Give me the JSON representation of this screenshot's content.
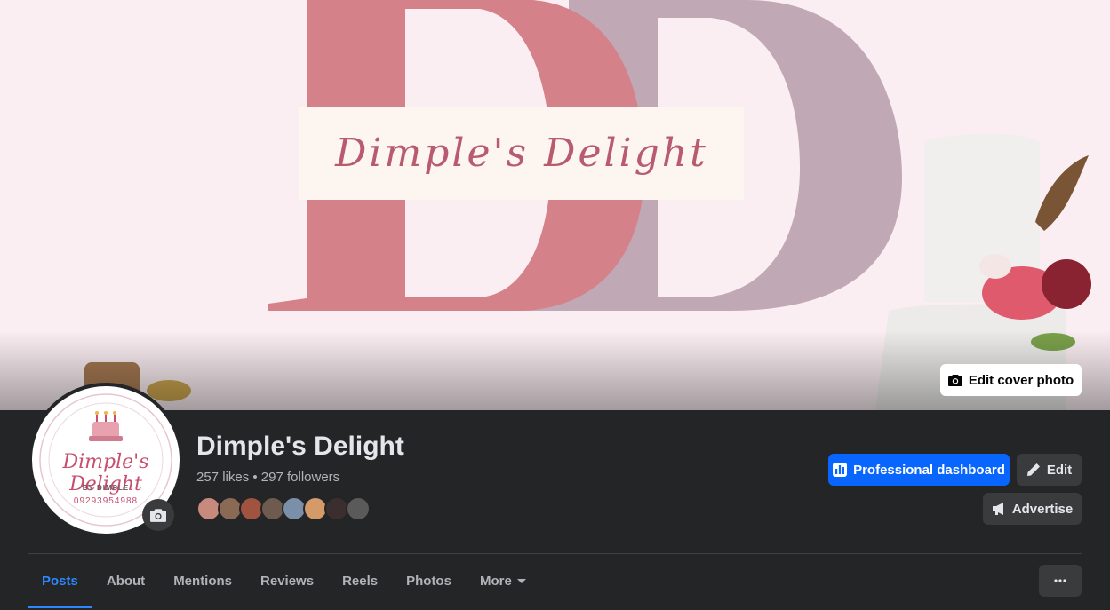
{
  "cover": {
    "banner_text": "Dimple's Delight",
    "edit_cover_label": "Edit cover photo",
    "colors": {
      "background": "#fbeef3",
      "rose": "#d58189",
      "mauve": "#c0a8b4"
    }
  },
  "profile": {
    "avatar_name": "Dimple's Delight",
    "avatar_sub": "BY DIMPLE",
    "avatar_phone": "09293954988",
    "page_name": "Dimple's Delight",
    "stats": "257 likes • 297 followers",
    "follower_colors": [
      "#c98a7e",
      "#8a6a55",
      "#a0533f",
      "#6e5a4e",
      "#7a8fa8",
      "#d59a6a",
      "#3a2e2e",
      "#5a5a5a"
    ]
  },
  "actions": {
    "professional_dashboard": "Professional dashboard",
    "edit": "Edit",
    "advertise": "Advertise"
  },
  "tabs": [
    "Posts",
    "About",
    "Mentions",
    "Reviews",
    "Reels",
    "Photos",
    "More"
  ],
  "accent": "#0866ff"
}
